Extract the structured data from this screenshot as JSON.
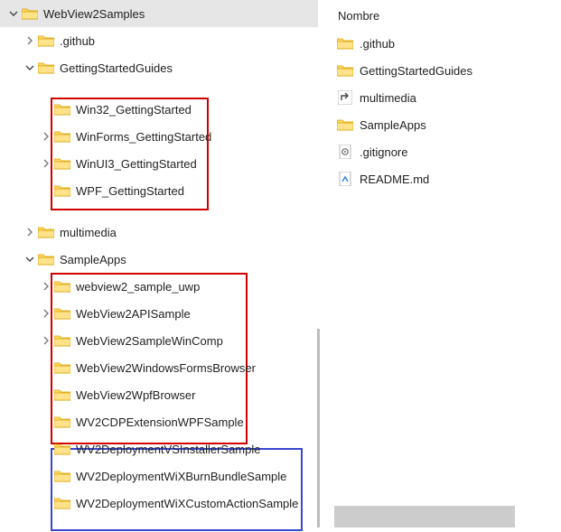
{
  "tree": {
    "root": {
      "label": "WebView2Samples"
    },
    "github": {
      "label": ".github"
    },
    "gettingStarted": {
      "label": "GettingStartedGuides"
    },
    "win32": {
      "label": "Win32_GettingStarted"
    },
    "winforms": {
      "label": "WinForms_GettingStarted"
    },
    "winui3": {
      "label": "WinUI3_GettingStarted"
    },
    "wpf": {
      "label": "WPF_GettingStarted"
    },
    "multimedia": {
      "label": "multimedia"
    },
    "sampleApps": {
      "label": "SampleApps"
    },
    "uwp": {
      "label": "webview2_sample_uwp"
    },
    "api": {
      "label": "WebView2APISample"
    },
    "wincomp": {
      "label": "WebView2SampleWinComp"
    },
    "winformsBrowser": {
      "label": "WebView2WindowsFormsBrowser"
    },
    "wpfBrowser": {
      "label": "WebView2WpfBrowser"
    },
    "cdp": {
      "label": "WV2CDPExtensionWPFSample"
    },
    "depVS": {
      "label": "WV2DeploymentVSInstallerSample"
    },
    "depBurn": {
      "label": "WV2DeploymentWiXBurnBundleSample"
    },
    "depCustom": {
      "label": "WV2DeploymentWiXCustomActionSample"
    }
  },
  "detail": {
    "columnHeader": "Nombre",
    "items": {
      "github": {
        "label": ".github"
      },
      "gettingStarted": {
        "label": "GettingStartedGuides"
      },
      "multimedia": {
        "label": "multimedia"
      },
      "sampleApps": {
        "label": "SampleApps"
      },
      "gitignore": {
        "label": ".gitignore"
      },
      "readme": {
        "label": "README.md"
      }
    }
  }
}
